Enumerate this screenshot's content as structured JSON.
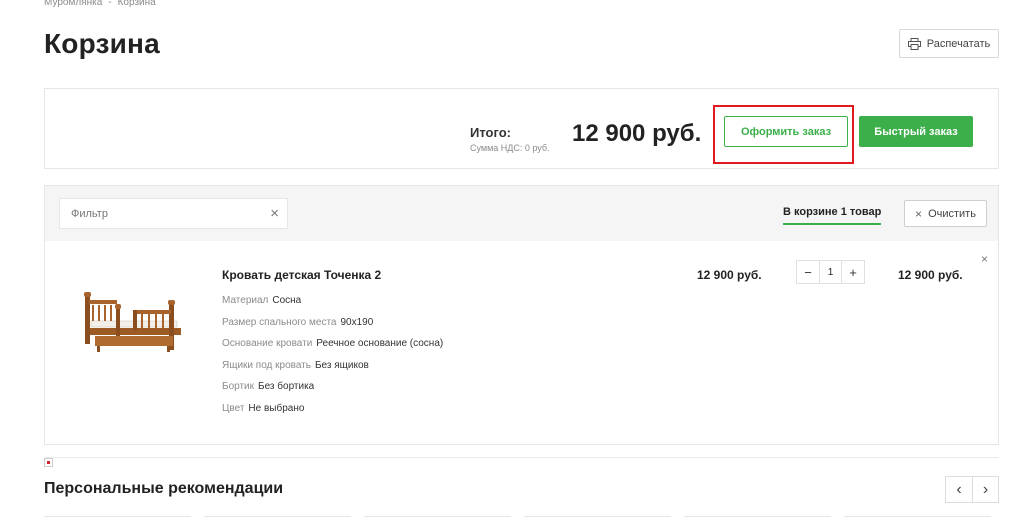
{
  "breadcrumb": [
    "Муромлянка",
    "Корзина"
  ],
  "breadcrumb_separator": "-",
  "page_title": "Корзина",
  "print_label": "Распечатать",
  "summary": {
    "total_label": "Итого:",
    "vat_label": "Сумма НДС: 0 руб.",
    "total_price": "12 900 руб.",
    "checkout_label": "Оформить заказ",
    "fast_order_label": "Быстрый заказ",
    "highlight_color": "#e0191f"
  },
  "basket": {
    "filter_placeholder": "Фильтр",
    "filter_clear_icon": "×",
    "cart_tab_label": "В корзине 1 товар",
    "clear_label": "Очистить",
    "clear_icon": "×",
    "item": {
      "name": "Кровать детская Точенка 2",
      "properties": [
        {
          "key": "Материал",
          "value": "Сосна"
        },
        {
          "key": "Размер спального места",
          "value": "90х190"
        },
        {
          "key": "Основание кровати",
          "value": "Реечное основание (сосна)"
        },
        {
          "key": "Ящики под кровать",
          "value": "Без ящиков"
        },
        {
          "key": "Бортик",
          "value": "Без бортика"
        },
        {
          "key": "Цвет",
          "value": "Не выбрано"
        }
      ],
      "price_each": "12 900 руб.",
      "quantity": "1",
      "minus_icon": "−",
      "plus_icon": "+",
      "price_total": "12 900 руб.",
      "remove_icon": "×"
    }
  },
  "recommendations": {
    "title": "Персональные рекомендации",
    "prev_icon": "‹",
    "next_icon": "›"
  },
  "colors": {
    "accent_green": "#3cae4a",
    "text_dark": "#222222",
    "text_muted": "#8b8b8b"
  }
}
